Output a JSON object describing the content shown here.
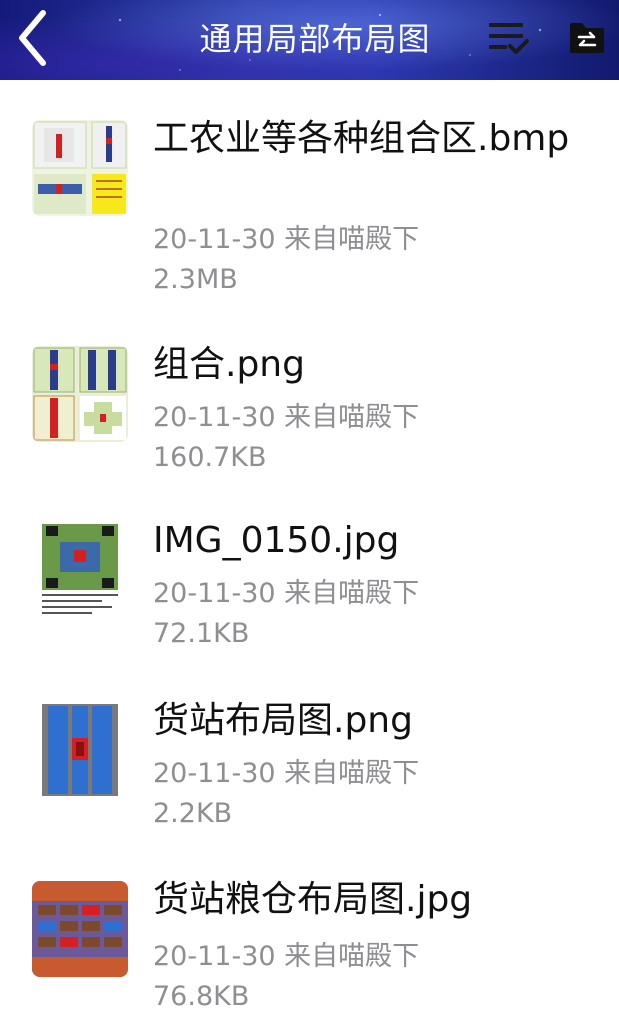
{
  "header": {
    "title": "通用局部布局图",
    "back_icon": "chevron-left-icon",
    "sort_icon": "list-check-icon",
    "folder_icon": "folder-transfer-icon"
  },
  "files": [
    {
      "name": "工农业等各种组合区.bmp",
      "date_source": "20-11-30 来自喵殿下",
      "size": "2.3MB"
    },
    {
      "name": "组合.png",
      "date_source": "20-11-30 来自喵殿下",
      "size": "160.7KB"
    },
    {
      "name": "IMG_0150.jpg",
      "date_source": "20-11-30 来自喵殿下",
      "size": "72.1KB"
    },
    {
      "name": "货站布局图.png",
      "date_source": "20-11-30 来自喵殿下",
      "size": "2.2KB"
    },
    {
      "name": "货站粮仓布局图.jpg",
      "date_source": "20-11-30 来自喵殿下",
      "size": "76.8KB"
    }
  ]
}
